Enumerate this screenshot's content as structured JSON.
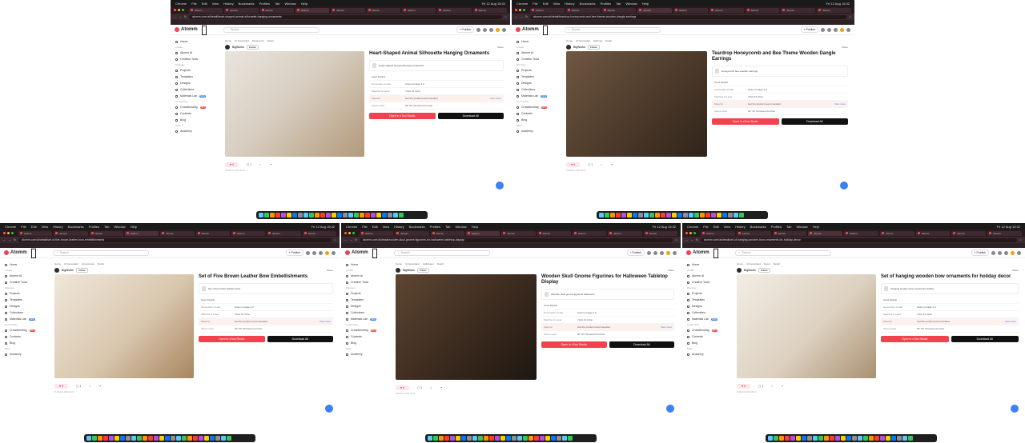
{
  "menubar": {
    "app": "Chrome",
    "items": [
      "File",
      "Edit",
      "View",
      "History",
      "Bookmarks",
      "Profiles",
      "Tab",
      "Window",
      "Help"
    ],
    "clock": "Fri 12 Aug 15:32"
  },
  "app": {
    "logo": "Atomm",
    "search_placeholder": "Search",
    "publish_label": "+ Publish",
    "share_label": "Share",
    "follow_label": "Follow",
    "like_count": "9",
    "comment_count": "1",
    "date": "Published 2024-08-12"
  },
  "sidebar": [
    {
      "type": "item",
      "label": "Home"
    },
    {
      "type": "section",
      "label": "Create"
    },
    {
      "type": "item",
      "label": "Atomm AI"
    },
    {
      "type": "item",
      "label": "Creative Tools"
    },
    {
      "type": "section",
      "label": "Discover"
    },
    {
      "type": "item",
      "label": "Projects"
    },
    {
      "type": "item",
      "label": "Templates"
    },
    {
      "type": "item",
      "label": "Designs"
    },
    {
      "type": "item",
      "label": "Collections"
    },
    {
      "type": "item",
      "label": "Materials Lab",
      "badge": "NEW"
    },
    {
      "type": "section",
      "label": "Community"
    },
    {
      "type": "item",
      "label": "Crowdfunding",
      "badge": "HOT",
      "badge_color": "red"
    },
    {
      "type": "item",
      "label": "Contests"
    },
    {
      "type": "item",
      "label": "Blog"
    },
    {
      "type": "section",
      "label": "More"
    },
    {
      "type": "item",
      "label": "Academy"
    }
  ],
  "labels": {
    "details": "Used Details",
    "k_model": "Generation model",
    "k_machine": "Machine & Laser",
    "k_material": "Material",
    "k_scene": "Scene used",
    "v_model": "Atomm Image 2.0",
    "v_machine": "xTool F1 Ultra",
    "v_material": "Get the product recommended",
    "v_scene": "20\" SV Ornament Format",
    "link": "View more",
    "open_btn": "Open in xTool Studio",
    "download_btn": "Download All"
  },
  "panels": [
    {
      "title": "Heart-Shaped Animal Silhouette Hanging Ornaments",
      "prompt": "Heart-shaped animal silhouette ornaments",
      "url": "atomm.com/ai/detail/heart-shaped-animal-silhouette-hanging-ornaments",
      "crumbs": [
        "Home",
        "AI Generated",
        "Ornaments",
        "Detail"
      ],
      "author": "BigWorks"
    },
    {
      "title": "Teardrop Honeycomb and Bee Theme Wooden Dangle Earrings",
      "prompt": "Honeycomb bee wooden earrings",
      "url": "atomm.com/ai/detail/teardrop-honeycomb-and-bee-theme-wooden-dangle-earrings",
      "crumbs": [
        "Home",
        "AI Generated",
        "Earrings",
        "Detail"
      ],
      "author": "BigWorks"
    },
    {
      "title": "Set of Five Brown Leather Bow Embellishments",
      "prompt": "Set of five brown leather bows",
      "url": "atomm.com/ai/detail/set-of-five-brown-leather-bow-embellishments",
      "crumbs": [
        "Home",
        "AI Generated",
        "Accessories",
        "Detail"
      ],
      "author": "BigWorks"
    },
    {
      "title": "Wooden Skull Gnome Figurines for Halloween Tabletop Display",
      "prompt": "Wooden skull gnome figurines halloween",
      "url": "atomm.com/ai/detail/wooden-skull-gnome-figurines-for-halloween-tabletop-display",
      "crumbs": [
        "Home",
        "AI Generated",
        "Halloween",
        "Detail"
      ],
      "author": "BigWorks"
    },
    {
      "title": "Set of hanging wooden bow ornaments for holiday decor",
      "prompt": "Hanging wooden bow ornaments holiday",
      "url": "atomm.com/ai/detail/set-of-hanging-wooden-bow-ornaments-for-holiday-decor",
      "crumbs": [
        "Home",
        "AI Generated",
        "Decor",
        "Detail"
      ],
      "author": "BigWorks"
    }
  ],
  "colors": {
    "accent": "#f2424e",
    "link": "#3b82f6",
    "chrome": "#2a1a1e"
  }
}
